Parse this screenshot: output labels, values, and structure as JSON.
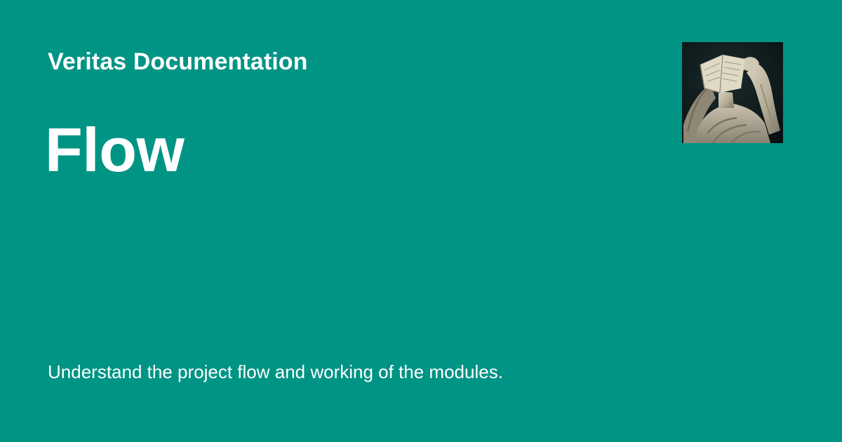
{
  "header": {
    "site_name": "Veritas Documentation"
  },
  "page": {
    "title": "Flow",
    "description": "Understand the project flow and working of the modules."
  },
  "logo": {
    "icon": "statue-holding-book-logo"
  },
  "colors": {
    "background": "#009485",
    "text": "#ffffff"
  }
}
